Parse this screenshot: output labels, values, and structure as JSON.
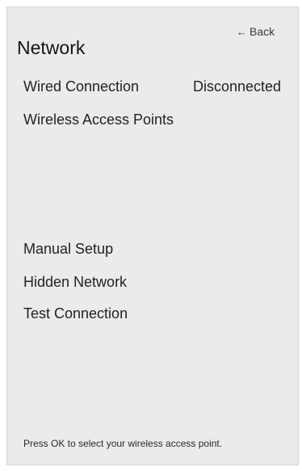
{
  "header": {
    "back_label": "Back",
    "back_arrow": "←",
    "title": "Network"
  },
  "menu": {
    "wired": {
      "label": "Wired Connection",
      "status": "Disconnected"
    },
    "wireless": {
      "label": "Wireless Access Points"
    },
    "manual": {
      "label": "Manual Setup"
    },
    "hidden": {
      "label": "Hidden Network"
    },
    "test": {
      "label": "Test Connection"
    }
  },
  "footer": {
    "hint": "Press OK to select your wireless access point."
  }
}
